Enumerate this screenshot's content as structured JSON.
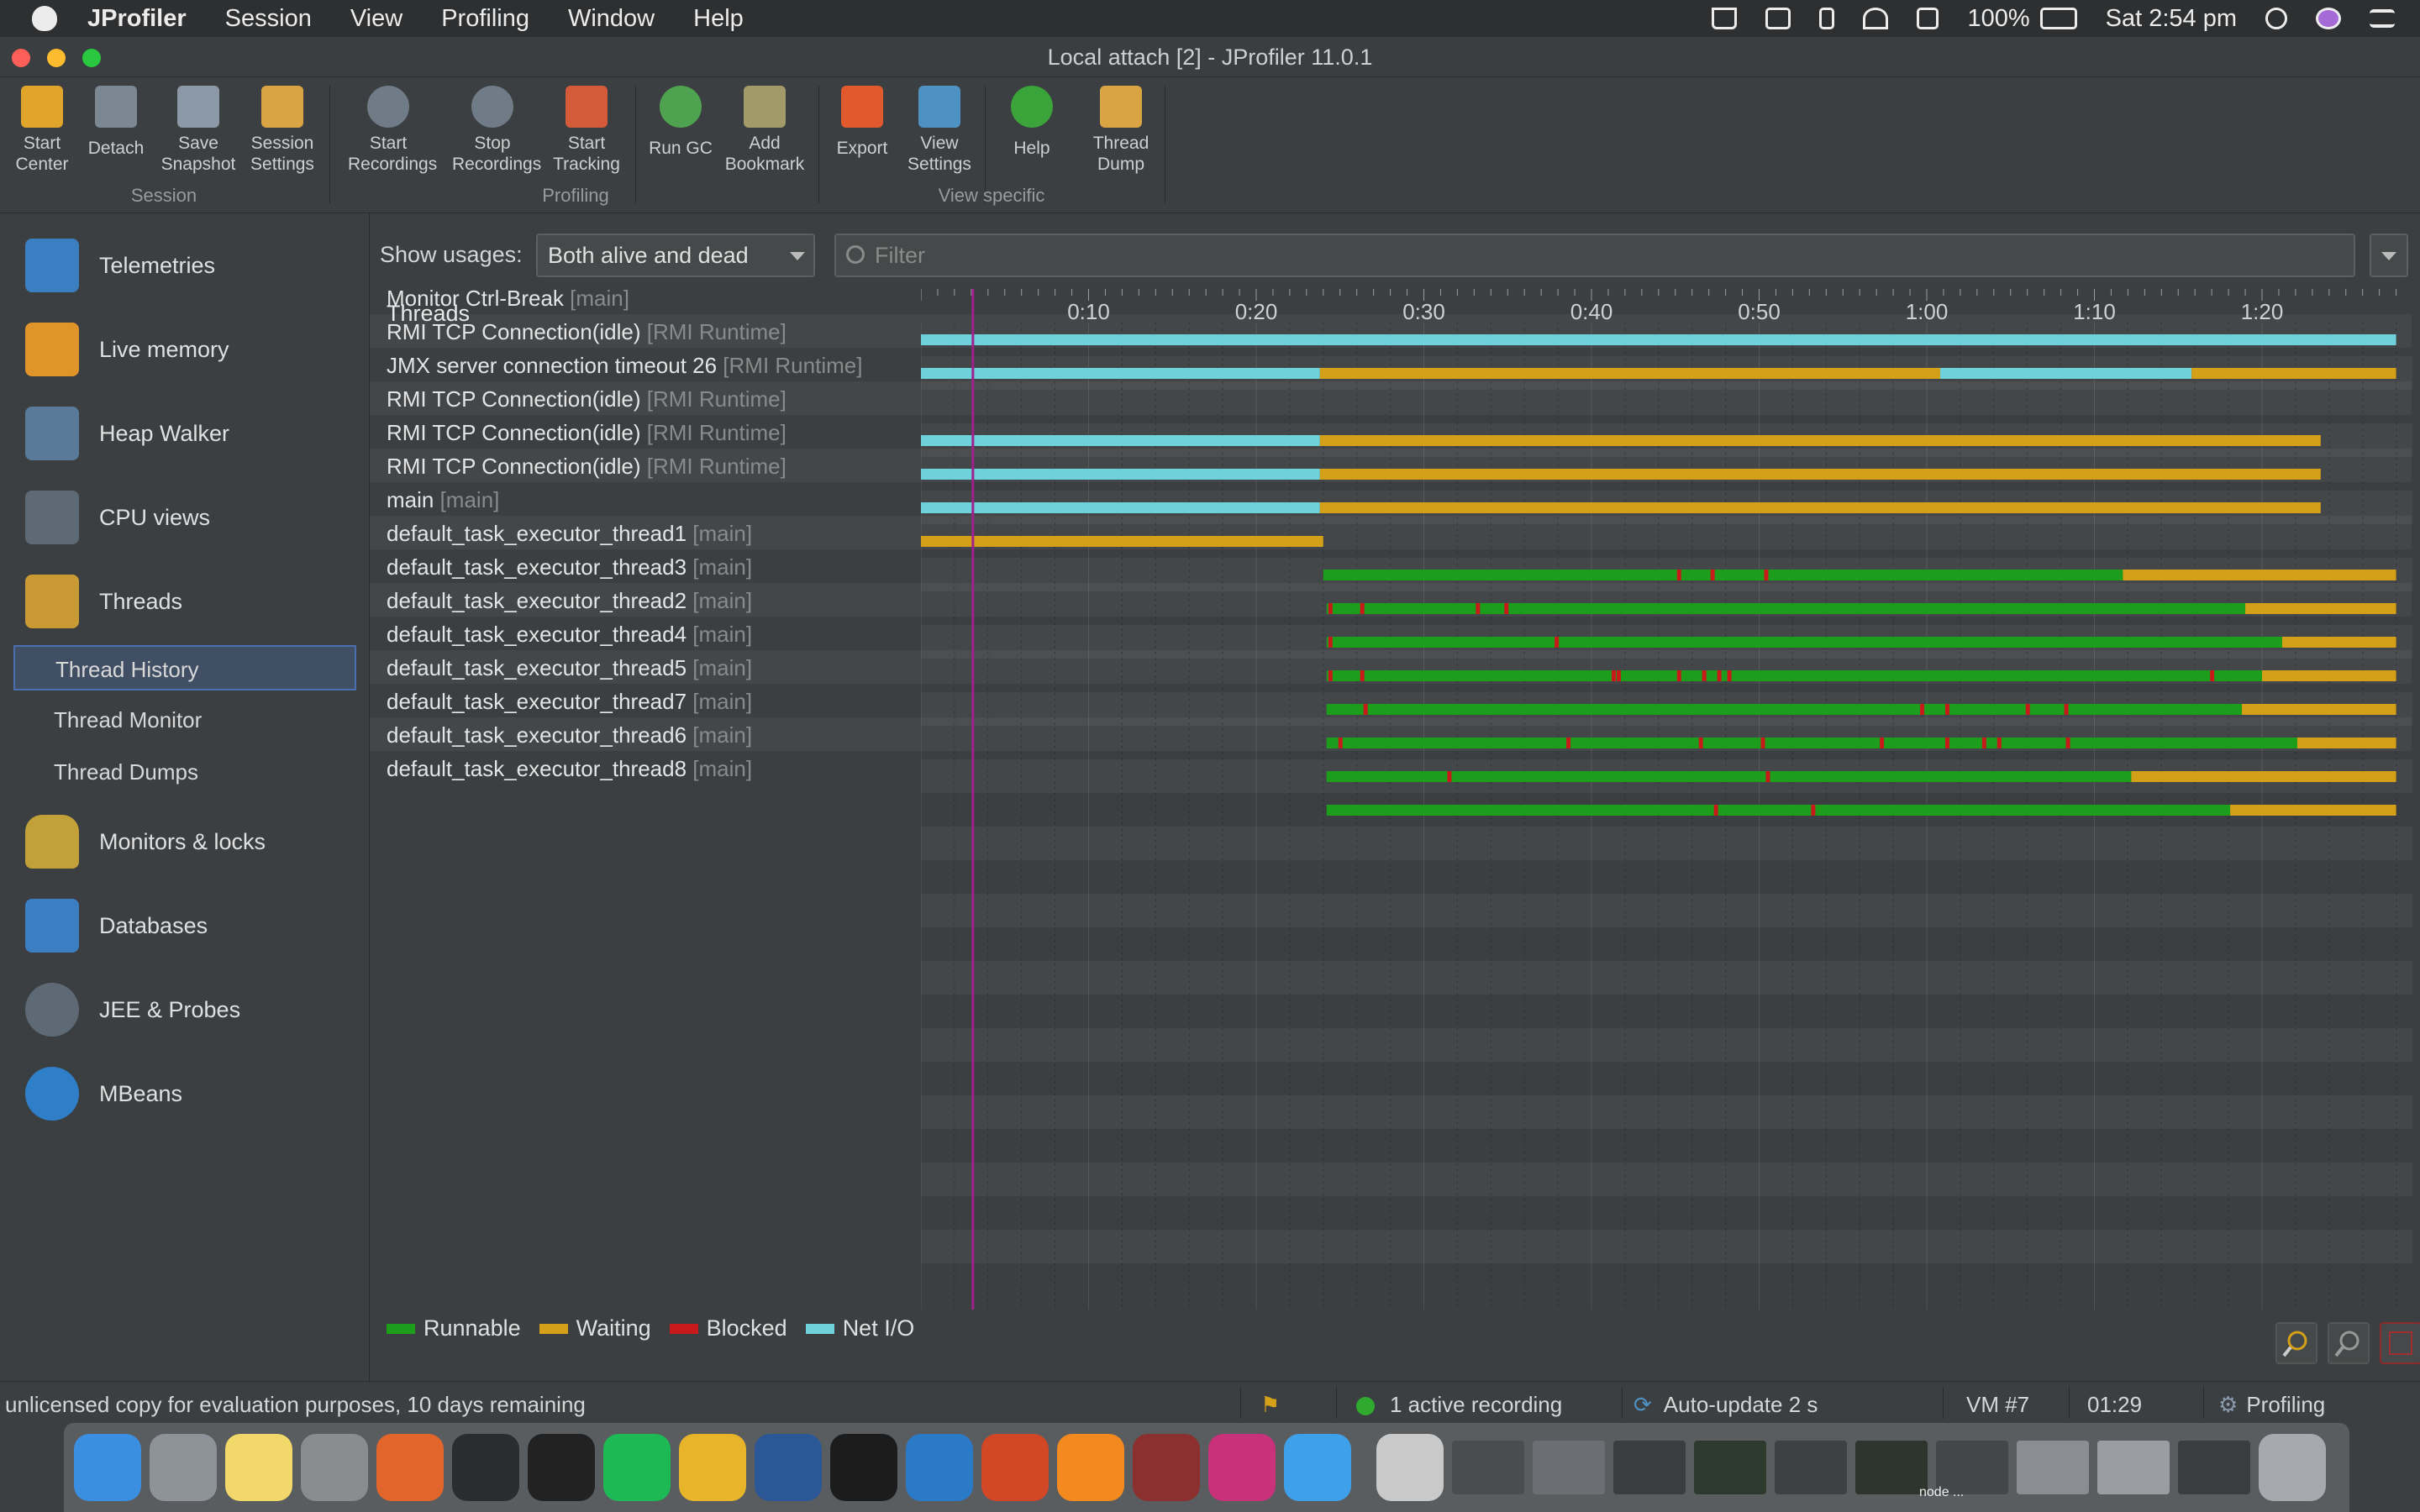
{
  "menubar": {
    "app": "JProfiler",
    "items": [
      "Session",
      "View",
      "Profiling",
      "Window",
      "Help"
    ],
    "battery": "100%",
    "clock": "Sat 2:54 pm"
  },
  "window": {
    "title": "Local attach [2] - JProfiler 11.0.1"
  },
  "toolbar": {
    "buttons": [
      {
        "label1": "Start",
        "label2": "Center",
        "icon": "start-center-icon"
      },
      {
        "label1": "Detach",
        "label2": "",
        "icon": "detach-icon"
      },
      {
        "label1": "Save",
        "label2": "Snapshot",
        "icon": "save-snapshot-icon"
      },
      {
        "label1": "Session",
        "label2": "Settings",
        "icon": "session-settings-icon"
      },
      {
        "label1": "Start",
        "label2": "Recordings",
        "icon": "start-recordings-icon"
      },
      {
        "label1": "Stop",
        "label2": "Recordings",
        "icon": "stop-recordings-icon"
      },
      {
        "label1": "Start",
        "label2": "Tracking",
        "icon": "start-tracking-icon"
      },
      {
        "label1": "Run GC",
        "label2": "",
        "icon": "run-gc-icon"
      },
      {
        "label1": "Add",
        "label2": "Bookmark",
        "icon": "add-bookmark-icon"
      },
      {
        "label1": "Export",
        "label2": "",
        "icon": "export-icon"
      },
      {
        "label1": "View",
        "label2": "Settings",
        "icon": "view-settings-icon"
      },
      {
        "label1": "Help",
        "label2": "",
        "icon": "help-icon"
      },
      {
        "label1": "Thread",
        "label2": "Dump",
        "icon": "thread-dump-icon"
      }
    ],
    "groups": [
      "Session",
      "Profiling",
      "View specific"
    ]
  },
  "sidebar": {
    "items": [
      {
        "label": "Telemetries",
        "icon": "telemetries-icon"
      },
      {
        "label": "Live memory",
        "icon": "live-memory-icon"
      },
      {
        "label": "Heap Walker",
        "icon": "heap-walker-icon"
      },
      {
        "label": "CPU views",
        "icon": "cpu-views-icon"
      },
      {
        "label": "Threads",
        "icon": "threads-icon"
      },
      {
        "label": "Monitors & locks",
        "icon": "monitors-locks-icon"
      },
      {
        "label": "Databases",
        "icon": "databases-icon"
      },
      {
        "label": "JEE & Probes",
        "icon": "jee-probes-icon"
      },
      {
        "label": "MBeans",
        "icon": "mbeans-icon"
      }
    ],
    "thread_sub": [
      "Thread History",
      "Thread Monitor",
      "Thread Dumps"
    ],
    "selected_sub": "Thread History"
  },
  "controls": {
    "show_usages_label": "Show usages:",
    "show_usages_value": "Both alive and dead",
    "filter_placeholder": "Filter"
  },
  "colors": {
    "runnable": "#1c9e1c",
    "waiting": "#d4a017",
    "blocked": "#c81a1a",
    "net_io": "#6fd1da",
    "cursor": "#a0208e"
  },
  "timeline": {
    "header": "Threads",
    "ticks": [
      "0:10",
      "0:20",
      "0:30",
      "0:40",
      "0:50",
      "1:00",
      "1:10",
      "1:20"
    ],
    "cursor_time_s": 3.1,
    "max_time_s": 88
  },
  "threads": [
    {
      "name": "Monitor Ctrl-Break",
      "group": "[main]",
      "segments": [
        [
          "net",
          0,
          88
        ]
      ],
      "marks": []
    },
    {
      "name": "RMI TCP Connection(idle)",
      "group": "[RMI Runtime]",
      "segments": [
        [
          "net",
          0,
          23.8
        ],
        [
          "wait",
          23.8,
          60.8
        ],
        [
          "net",
          60.8,
          75.8
        ],
        [
          "wait",
          75.8,
          88
        ]
      ],
      "marks": []
    },
    {
      "name": "JMX server connection timeout 26",
      "group": "[RMI Runtime]",
      "segments": [],
      "marks": []
    },
    {
      "name": "RMI TCP Connection(idle)",
      "group": "[RMI Runtime]",
      "segments": [
        [
          "net",
          0,
          23.8
        ],
        [
          "wait",
          23.8,
          83.5
        ]
      ],
      "marks": []
    },
    {
      "name": "RMI TCP Connection(idle)",
      "group": "[RMI Runtime]",
      "segments": [
        [
          "net",
          0,
          23.8
        ],
        [
          "wait",
          23.8,
          83.5
        ]
      ],
      "marks": []
    },
    {
      "name": "RMI TCP Connection(idle)",
      "group": "[RMI Runtime]",
      "segments": [
        [
          "net",
          0,
          23.8
        ],
        [
          "wait",
          23.8,
          83.5
        ]
      ],
      "marks": []
    },
    {
      "name": "main",
      "group": "[main]",
      "segments": [
        [
          "wait",
          0,
          24
        ]
      ],
      "marks": []
    },
    {
      "name": "default_task_executor_thread1",
      "group": "[main]",
      "segments": [
        [
          "run",
          24,
          71.7
        ],
        [
          "wait",
          71.7,
          88
        ]
      ],
      "marks": [
        45.1,
        47.1,
        50.3
      ]
    },
    {
      "name": "default_task_executor_thread3",
      "group": "[main]",
      "segments": [
        [
          "run",
          24.2,
          79
        ],
        [
          "wait",
          79,
          88
        ]
      ],
      "marks": [
        24.3,
        26.2,
        33.1,
        34.8
      ]
    },
    {
      "name": "default_task_executor_thread2",
      "group": "[main]",
      "segments": [
        [
          "run",
          24.2,
          81.2
        ],
        [
          "wait",
          81.2,
          88
        ]
      ],
      "marks": [
        24.3,
        37.8
      ]
    },
    {
      "name": "default_task_executor_thread4",
      "group": "[main]",
      "segments": [
        [
          "run",
          24.2,
          80
        ],
        [
          "wait",
          80,
          88
        ]
      ],
      "marks": [
        24.3,
        26.2,
        41.2,
        41.5,
        45.1,
        46.6,
        47.5,
        48.1,
        76.9
      ]
    },
    {
      "name": "default_task_executor_thread5",
      "group": "[main]",
      "segments": [
        [
          "run",
          24.2,
          78.8
        ],
        [
          "wait",
          78.8,
          88
        ]
      ],
      "marks": [
        26.4,
        59.6,
        61.1,
        65.9,
        68.2
      ]
    },
    {
      "name": "default_task_executor_thread7",
      "group": "[main]",
      "segments": [
        [
          "run",
          24.2,
          82.1
        ],
        [
          "wait",
          82.1,
          88
        ]
      ],
      "marks": [
        24.9,
        38.5,
        46.4,
        50.1,
        57.2,
        61.1,
        63.3,
        64.2,
        68.3
      ]
    },
    {
      "name": "default_task_executor_thread6",
      "group": "[main]",
      "segments": [
        [
          "run",
          24.2,
          72.2
        ],
        [
          "wait",
          72.2,
          88
        ]
      ],
      "marks": [
        31.4,
        50.4
      ]
    },
    {
      "name": "default_task_executor_thread8",
      "group": "[main]",
      "segments": [
        [
          "run",
          24.2,
          78.1
        ],
        [
          "wait",
          78.1,
          88
        ]
      ],
      "marks": [
        47.3,
        53.1
      ]
    }
  ],
  "legend": [
    "Runnable",
    "Waiting",
    "Blocked",
    "Net I/O"
  ],
  "status": {
    "license": "unlicensed copy for evaluation purposes, 10 days remaining",
    "recording": "1 active recording",
    "autoupdate": "Auto-update 2 s",
    "vm": "VM #7",
    "time": "01:29",
    "mode": "Profiling"
  },
  "dock": {
    "apps": [
      {
        "icon": "finder-icon",
        "color": "#3b8fe0"
      },
      {
        "icon": "launchpad-icon",
        "color": "#8e9399"
      },
      {
        "icon": "notes-icon",
        "color": "#f2d86a"
      },
      {
        "icon": "system-preferences-icon",
        "color": "#8a8d90"
      },
      {
        "icon": "firefox-icon",
        "color": "#e2662b"
      },
      {
        "icon": "activity-monitor-icon",
        "color": "#2a2d2f"
      },
      {
        "icon": "terminal-dark-icon",
        "color": "#222"
      },
      {
        "icon": "spotify-icon",
        "color": "#1db954"
      },
      {
        "icon": "chrome-icon",
        "color": "#e8b52a"
      },
      {
        "icon": "word-icon",
        "color": "#2b5797"
      },
      {
        "icon": "terminal-icon",
        "color": "#1c1c1c"
      },
      {
        "icon": "vscode-icon",
        "color": "#2a7ac8"
      },
      {
        "icon": "powerpoint-icon",
        "color": "#d24726"
      },
      {
        "icon": "vlc-icon",
        "color": "#f28a1f"
      },
      {
        "icon": "dictionary-icon",
        "color": "#8c2f2f"
      },
      {
        "icon": "intellij-icon",
        "color": "#c9327a"
      },
      {
        "icon": "safari-icon",
        "color": "#3ea0e8"
      },
      {
        "icon": "preview-icon",
        "color": "#c9c9c9"
      },
      {
        "icon": "window-thumbnail-icon",
        "color": "#4a4d50"
      },
      {
        "icon": "window-thumbnail-icon",
        "color": "#6b6e72"
      },
      {
        "icon": "window-thumbnail-icon",
        "color": "#3a3d40"
      },
      {
        "icon": "window-thumbnail-icon",
        "color": "#2f3a2f"
      },
      {
        "icon": "window-thumbnail-icon",
        "color": "#3e4144"
      },
      {
        "icon": "window-thumbnail-icon",
        "color": "#2e342e"
      },
      {
        "icon": "window-thumbnail-icon",
        "color": "#44474a"
      },
      {
        "icon": "window-thumbnail-icon",
        "color": "#8a8d91"
      },
      {
        "icon": "window-thumbnail-icon",
        "color": "#9a9da1"
      },
      {
        "icon": "window-thumbnail-icon",
        "color": "#3a3d40"
      },
      {
        "icon": "trash-icon",
        "color": "#a6a9ad"
      }
    ],
    "node_label": "node ..."
  }
}
